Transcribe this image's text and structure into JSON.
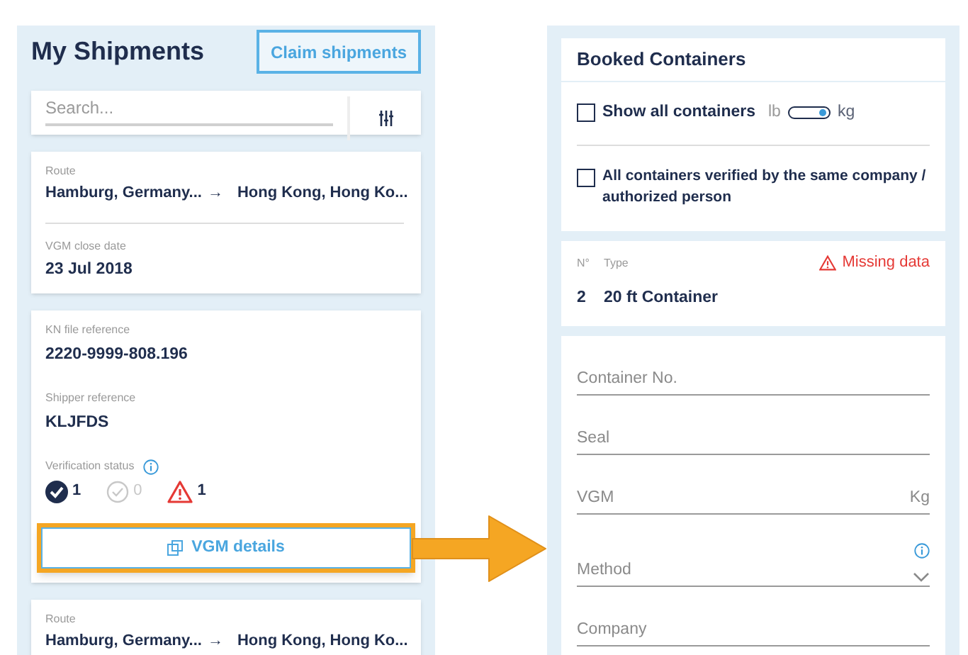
{
  "shipments": {
    "title": "My Shipments",
    "claim_button": "Claim shipments",
    "search": {
      "placeholder": "Search..."
    },
    "cards": [
      {
        "kind": "route",
        "label": "Route",
        "from": "Hamburg, Germany...",
        "arrow": "→",
        "to": "Hong Kong, Hong Ko...",
        "date_label": "VGM close date",
        "date": "23 Jul 2018"
      },
      {
        "kind": "details",
        "fields": [
          {
            "label": "KN file reference",
            "value": "2220-9999-808.196"
          },
          {
            "label": "Shipper reference",
            "value": "KLJFDS"
          }
        ],
        "status_label": "Verification status",
        "statuses": [
          {
            "kind": "verified",
            "count": "1"
          },
          {
            "kind": "pending",
            "count": "0"
          },
          {
            "kind": "warning",
            "count": "1"
          }
        ],
        "button": "VGM details",
        "highlighted": true
      },
      {
        "kind": "route",
        "label": "Route",
        "from": "Hamburg, Germany...",
        "arrow": "→",
        "to": "Hong Kong, Hong Ko..."
      }
    ]
  },
  "containers": {
    "title": "Booked Containers",
    "show_all": {
      "label": "Show all containers",
      "checked": false
    },
    "unit_toggle": {
      "left": "lb",
      "right": "kg",
      "on": true
    },
    "same_company": {
      "label": "All containers verified by the same company / authorized person",
      "checked": false
    },
    "container": {
      "no_label": "N°",
      "type_label": "Type",
      "warning": "Missing data",
      "no": "2",
      "type": "20 ft Container"
    },
    "fields": [
      {
        "kind": "text",
        "placeholder": "Container No."
      },
      {
        "kind": "text",
        "placeholder": "Seal"
      },
      {
        "kind": "unit",
        "placeholder": "VGM",
        "unit": "Kg"
      },
      {
        "kind": "select",
        "placeholder": "Method"
      },
      {
        "kind": "text",
        "placeholder": "Company"
      }
    ]
  }
}
